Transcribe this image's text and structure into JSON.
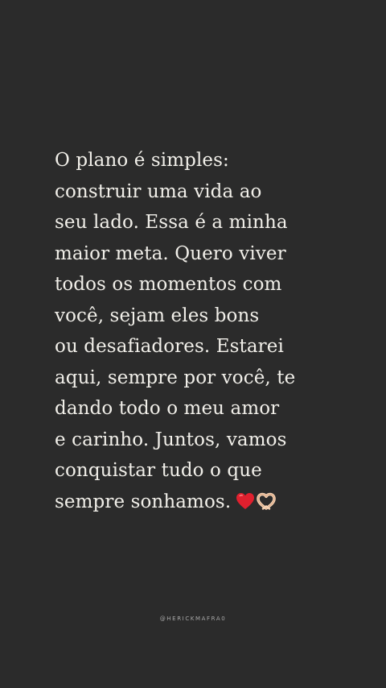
{
  "quote": {
    "lines": [
      "O plano é simples:",
      "construir uma vida ao",
      "seu lado. Essa é a minha",
      "maior meta. Quero viver",
      "todos os momentos com",
      "você, sejam eles bons",
      "ou desafiadores. Estarei",
      "aqui, sempre por você, te",
      "dando todo o meu amor",
      "e carinho. Juntos, vamos",
      "conquistar tudo o que",
      "sempre sonhamos."
    ],
    "emojis": [
      "red-heart",
      "heart-hands"
    ]
  },
  "watermark": "@HERICKMAFRA0"
}
